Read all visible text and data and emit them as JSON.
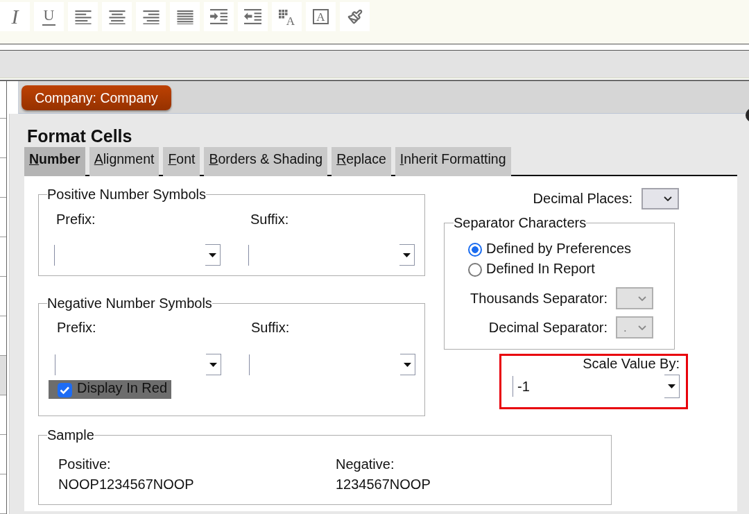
{
  "toolbar": [
    {
      "kind": "italic",
      "glyph": "I"
    },
    {
      "kind": "underline",
      "glyph": "U"
    },
    {
      "kind": "align-left"
    },
    {
      "kind": "align-center"
    },
    {
      "kind": "align-right"
    },
    {
      "kind": "justify"
    },
    {
      "kind": "indent"
    },
    {
      "kind": "outdent"
    },
    {
      "kind": "number-format",
      "glyph": "A"
    },
    {
      "kind": "text-frame",
      "glyph": "A"
    },
    {
      "kind": "brush"
    }
  ],
  "side_grid": {
    "rows": [
      {
        "selected": false
      },
      {
        "selected": false
      },
      {
        "selected": false
      },
      {
        "selected": false
      },
      {
        "selected": false
      },
      {
        "selected": false
      },
      {
        "selected": false
      },
      {
        "selected": true
      },
      {
        "selected": false
      },
      {
        "selected": false
      },
      {
        "selected": false
      }
    ]
  },
  "context_button": {
    "label": "Company: Company"
  },
  "dialog": {
    "title": "Format Cells",
    "tabs": [
      {
        "label": "Number",
        "selected": true
      },
      {
        "label": "Alignment",
        "selected": false
      },
      {
        "label": "Font",
        "selected": false
      },
      {
        "label": "Borders & Shading",
        "selected": false
      },
      {
        "label": "Replace",
        "selected": false
      },
      {
        "label": "Inherit Formatting",
        "selected": false
      }
    ],
    "positive_symbols": {
      "legend": "Positive Number Symbols",
      "prefix": {
        "label": "Prefix:"
      },
      "suffix": {
        "label": "Suffix:"
      }
    },
    "negative_symbols": {
      "legend": "Negative Number Symbols",
      "prefix": {
        "label": "Prefix:"
      },
      "suffix": {
        "label": "Suffix:"
      },
      "display_in_red": {
        "label": "Display In Red",
        "checked": true,
        "highlighted": true
      }
    },
    "decimal_places": {
      "label": "Decimal Places:",
      "disabled": false
    },
    "separator": {
      "legend": "Separator Characters",
      "options": [
        {
          "label": "Defined by Preferences",
          "selected": true
        },
        {
          "label": "Defined In Report",
          "selected": false
        }
      ],
      "thousands": {
        "label": "Thousands Separator:",
        "disabled": true
      },
      "decimal": {
        "label": "Decimal Separator:",
        "value": ".",
        "disabled": true
      }
    },
    "scale": {
      "label": "Scale Value By:",
      "value": "-1",
      "highlighted": true
    },
    "sample": {
      "legend": "Sample",
      "positive_label": "Positive:",
      "positive_value": "NOOP1234567NOOP",
      "negative_label": "Negative:",
      "negative_value": "1234567NOOP"
    }
  }
}
